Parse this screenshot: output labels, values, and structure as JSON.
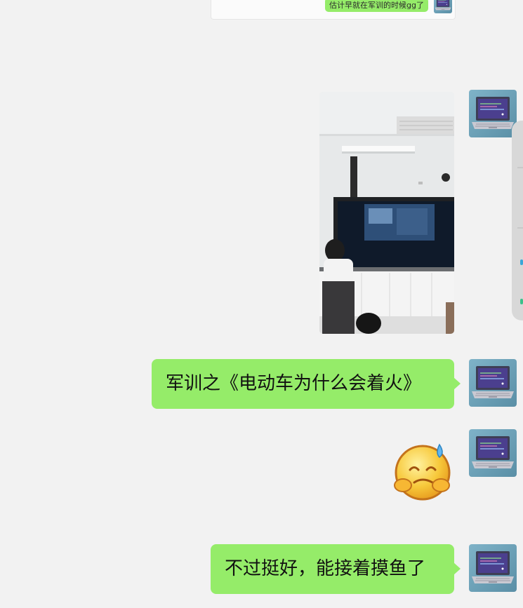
{
  "chat": {
    "quoted_message": {
      "text": "估计早就在军训的时候gg了"
    },
    "messages": [
      {
        "type": "image",
        "description": "photo"
      },
      {
        "type": "text",
        "text": "军训之《电动车为什么会着火》"
      },
      {
        "type": "sticker",
        "icon": "sweat-smile-emoji"
      },
      {
        "type": "text",
        "text": "不过挺好，能接着摸鱼了"
      }
    ]
  },
  "colors": {
    "background": "#f2f2f2",
    "outgoing_bubble": "#95ec69",
    "side_panel": "#d8d8d8"
  }
}
